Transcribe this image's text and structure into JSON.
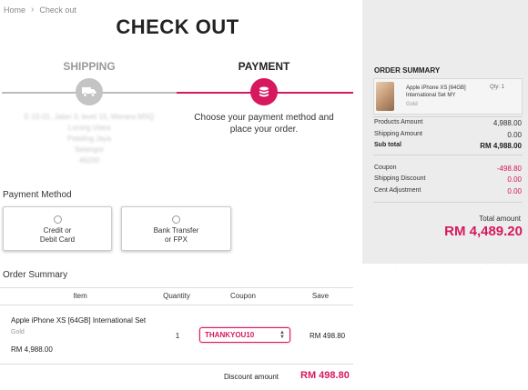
{
  "breadcrumb": {
    "home": "Home",
    "current": "Check out"
  },
  "page_title": "CHECK OUT",
  "steps": {
    "shipping": "SHIPPING",
    "payment": "PAYMENT",
    "shipping_icon": "truck-icon",
    "payment_icon": "coins-icon"
  },
  "address": {
    "line1": "E-15-01, Jalan 3, level 15, Menara MSQ",
    "line2": "Lorong Utara",
    "line3": "Petaling Jaya",
    "line4": "Selangor",
    "line5": "46200"
  },
  "payment_prompt": "Choose your payment method and place your order.",
  "payment_method": {
    "heading": "Payment Method",
    "options": [
      {
        "line1": "Credit or",
        "line2": "Debit Card"
      },
      {
        "line1": "Bank Transfer",
        "line2": "or FPX"
      }
    ]
  },
  "order_summary": {
    "heading": "Order Summary",
    "columns": {
      "item": "Item",
      "quantity": "Quantity",
      "coupon": "Coupon",
      "save": "Save"
    },
    "item": {
      "name": "Apple iPhone XS [64GB] International Set",
      "variant": "Gold",
      "price": "RM 4,988.00",
      "quantity": "1",
      "coupon": "THANKYOU10",
      "save": "RM 498.80"
    },
    "discount_label": "Discount amount",
    "discount_amount": "RM 498.80"
  },
  "summary_panel": {
    "title": "ORDER SUMMARY",
    "product": {
      "name": "Apple iPhone XS [64GB] International Set MY",
      "variant": "Gold",
      "qty": "Qty: 1"
    },
    "rows": {
      "products_amount": {
        "label": "Products Amount",
        "value": "4,988.00"
      },
      "shipping_amount": {
        "label": "Shipping Amount",
        "value": "0.00"
      },
      "sub_total": {
        "label": "Sub total",
        "value": "RM 4,988.00"
      },
      "coupon": {
        "label": "Coupon",
        "value": "-498.80"
      },
      "shipping_discount": {
        "label": "Shipping Discount",
        "value": "0.00"
      },
      "cent_adjustment": {
        "label": "Cent Adjustment",
        "value": "0.00"
      }
    },
    "total_label": "Total amount",
    "total_value": "RM 4,489.20"
  },
  "colors": {
    "accent": "#d6185e",
    "panel_bg": "#ececec",
    "muted": "#999999"
  }
}
